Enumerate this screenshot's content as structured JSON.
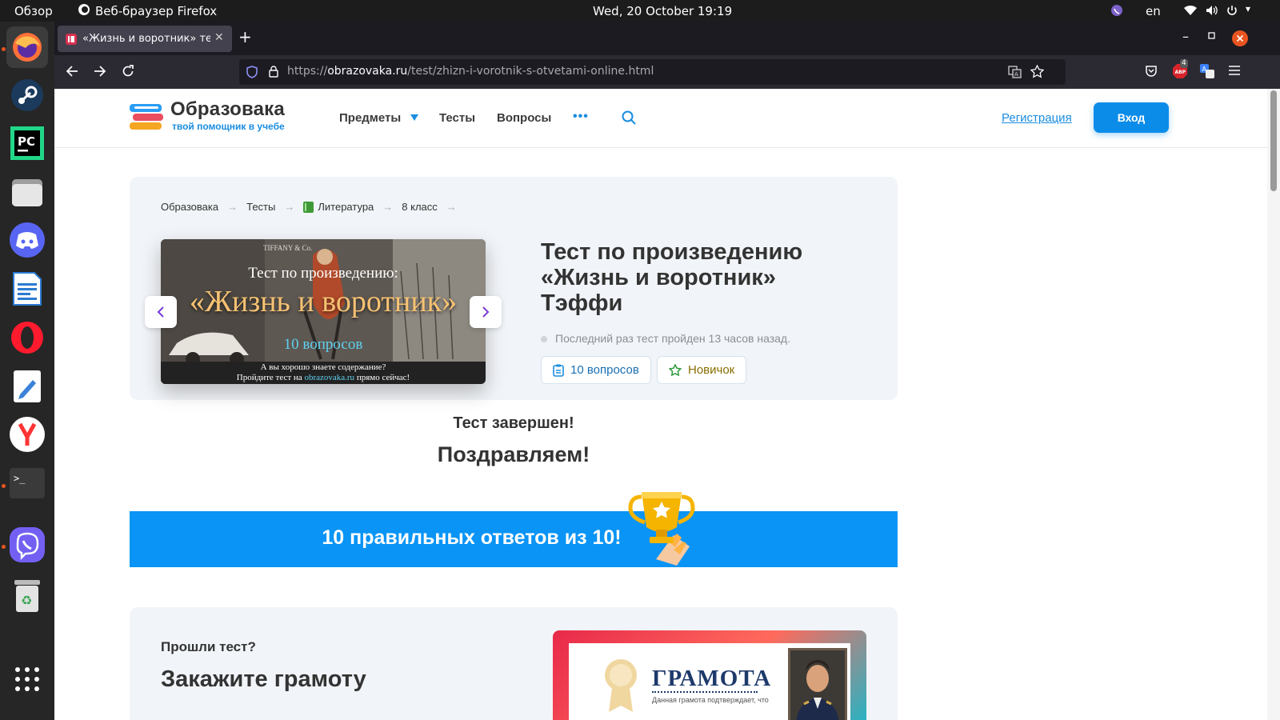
{
  "system_bar": {
    "activities": "Обзор",
    "app_name": "Веб-браузер Firefox",
    "clock": "Wed, 20 October  19:19",
    "lang": "en"
  },
  "dock": {
    "items": [
      "firefox",
      "steam",
      "pycharm",
      "files",
      "discord",
      "libreoffice-writer",
      "opera",
      "text-editor",
      "yandex-browser",
      "terminal",
      "viber",
      "trash",
      "show-apps"
    ]
  },
  "browser": {
    "tab_title": "«Жизнь и воротник» тест",
    "url_prefix": "https://",
    "url_domain": "obrazovaka.ru",
    "url_path": "/test/zhizn-i-vorotnik-s-otvetami-online.html",
    "abp_badge": "4"
  },
  "site_header": {
    "logo_name": "Образовака",
    "logo_tagline": "твой помощник в учебе",
    "nav": [
      "Предметы",
      "Тесты",
      "Вопросы"
    ],
    "more": "•••",
    "register": "Регистрация",
    "login": "Вход"
  },
  "breadcrumb": [
    "Образовака",
    "Тесты",
    "Литература",
    "8 класс"
  ],
  "cover": {
    "line1": "Тест по произведению:",
    "line2": "«Жизнь и воротник»",
    "line3": "10 вопросов",
    "line4": "А вы хорошо знаете содержание?",
    "line5_a": "Пройдите тест на ",
    "line5_link": "obrazovaka.ru",
    "line5_b": " прямо сейчас!",
    "sign": "TIFFANY & Co."
  },
  "test": {
    "title_l1": "Тест по произведению",
    "title_l2": "«Жизнь и воротник»",
    "title_l3": "Тэффи",
    "last_taken": "Последний раз тест пройден 13 часов назад.",
    "questions_pill": "10 вопросов",
    "level_pill": "Новичок"
  },
  "result": {
    "done": "Тест завершен!",
    "congrats": "Поздравляем!",
    "score": "10 правильных ответов из 10!"
  },
  "promo": {
    "question": "Прошли тест?",
    "cta": "Закажите грамоту",
    "cert_title": "ГРАМОТА",
    "cert_sub": "Данная грамота подтверждает, что"
  },
  "colors": {
    "accent": "#0c8ce9",
    "banner": "#0a94f6",
    "text_dark": "#333333",
    "panel": "#f1f4f8"
  }
}
